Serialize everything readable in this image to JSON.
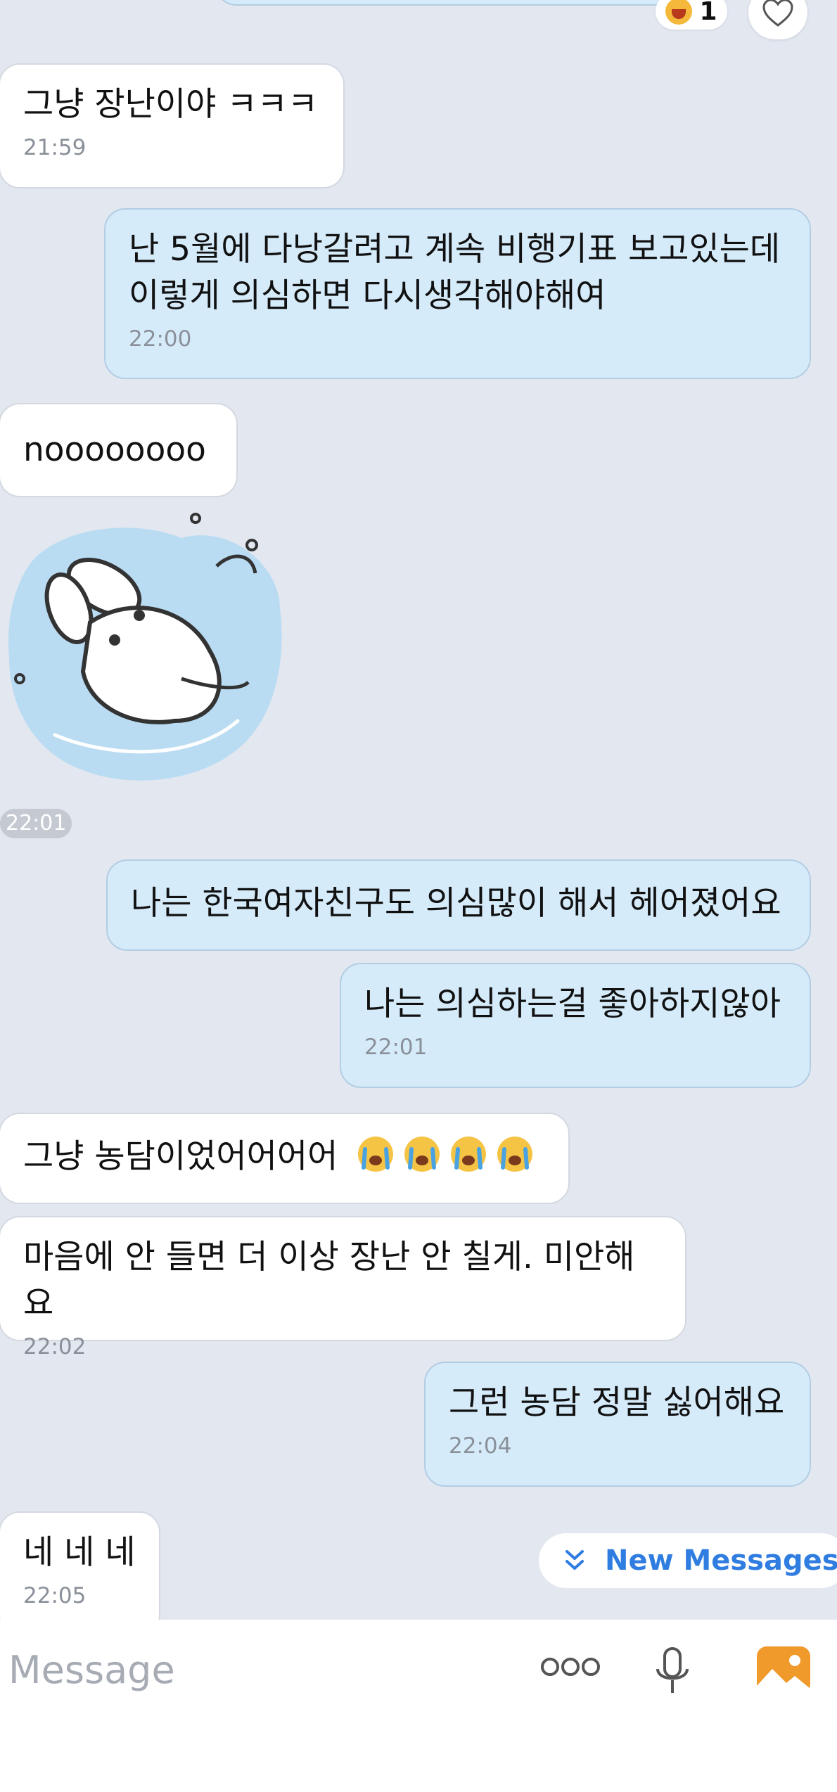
{
  "top_reaction": {
    "count": "1"
  },
  "messages": [
    {
      "text": "그냥 장난이야 ㅋㅋㅋ",
      "time": "21:59"
    },
    {
      "text": "난 5월에 다낭갈려고 계속 비행기표 보고있는데\n이렇게 의심하면 다시생각해야해여",
      "time": "22:00"
    },
    {
      "text": "noooooooo"
    },
    {
      "sticker_time": "22:01"
    },
    {
      "text": "나는 한국여자친구도 의심많이 해서 헤어졌어요"
    },
    {
      "text": "나는 의심하는걸 좋아하지않아",
      "time": "22:01"
    },
    {
      "text": "그냥 농담이었어어어어"
    },
    {
      "text": "마음에 안 들면 더 이상 장난 안 칠게. 미안해요",
      "time": "22:02"
    },
    {
      "text": "그런 농담 정말 싫어해요",
      "time": "22:04"
    },
    {
      "text": "네 네 네",
      "time": "22:05"
    }
  ],
  "new_messages_label": "New Messages",
  "input": {
    "placeholder": "Message"
  },
  "colors": {
    "incoming": "#ffffff",
    "outgoing": "#d6ebfa",
    "background": "#e2e7f0",
    "accent": "#2f7de1"
  },
  "icons": [
    "laughing-emoji-icon",
    "heart-icon",
    "crying-emoji-icon",
    "chevron-double-down-icon",
    "more-dots-icon",
    "microphone-icon",
    "gallery-icon"
  ]
}
